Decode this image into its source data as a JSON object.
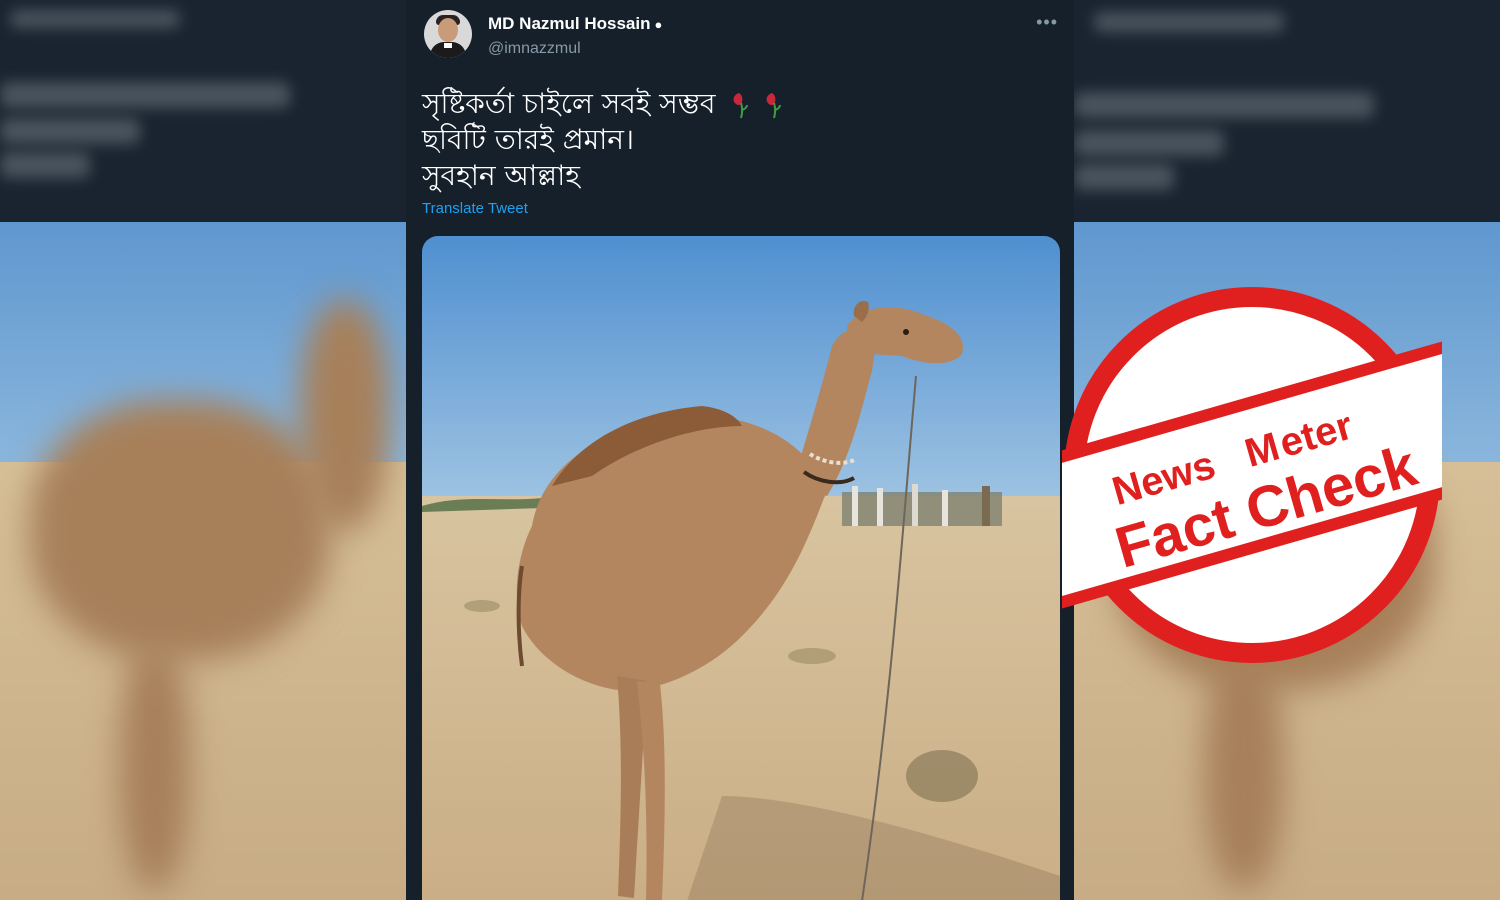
{
  "tweet": {
    "author_name": "MD Nazmul Hossain",
    "author_handle": "@imnazzmul",
    "text_lines": [
      "সৃষ্টিকর্তা চাইলে সবই সম্ভব",
      "ছবিটি তারই প্রমান।",
      "সুবহান আল্লাহ"
    ],
    "translate_label": "Translate Tweet",
    "more_icon": "more-icon",
    "emoji": "wilted-flower"
  },
  "stamp": {
    "brand_part1": "News",
    "brand_part2": "eter",
    "label": "Fact Check",
    "color": "#e0201f"
  },
  "colors": {
    "tweet_bg": "#15202b",
    "link": "#1da1f2",
    "secondary": "#8899a6"
  }
}
